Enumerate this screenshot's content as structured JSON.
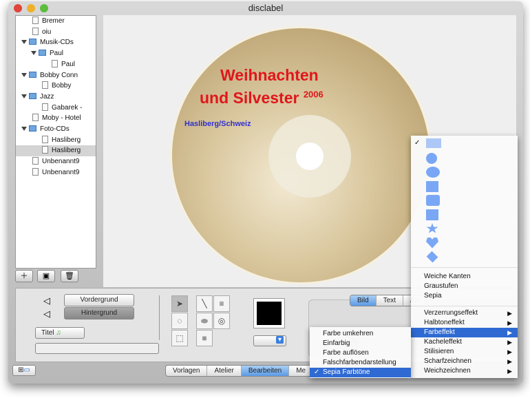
{
  "window": {
    "title": "disclabel"
  },
  "sidebar": {
    "items": [
      {
        "label": "Bremer",
        "type": "doc",
        "level": 1
      },
      {
        "label": "oiu",
        "type": "doc",
        "level": 1
      },
      {
        "label": "Musik-CDs",
        "type": "folder",
        "level": 0
      },
      {
        "label": "Paul",
        "type": "folder",
        "level": 1
      },
      {
        "label": "Paul",
        "type": "doc",
        "level": 3
      },
      {
        "label": "Bobby Conn",
        "type": "folder",
        "level": 0
      },
      {
        "label": "Bobby",
        "type": "doc",
        "level": 2
      },
      {
        "label": "Jazz",
        "type": "folder",
        "level": 0
      },
      {
        "label": "Gabarek -",
        "type": "doc",
        "level": 2
      },
      {
        "label": "Moby - Hotel",
        "type": "doc",
        "level": 1
      },
      {
        "label": "Foto-CDs",
        "type": "folder",
        "level": 0
      },
      {
        "label": "Hasliberg",
        "type": "doc",
        "level": 2
      },
      {
        "label": "Hasliberg",
        "type": "doc",
        "level": 2,
        "selected": true
      },
      {
        "label": "Unbenannt9",
        "type": "doc",
        "level": 1
      },
      {
        "label": "Unbenannt9",
        "type": "doc",
        "level": 1
      }
    ]
  },
  "disc": {
    "line1": "Weihnachten",
    "line2": "und Silvester",
    "year": "2006",
    "subtitle": "Hasliberg/Schweiz"
  },
  "panel": {
    "foreground": "Vordergrund",
    "background": "Hintergrund",
    "field_select": "Titel",
    "inspector_tabs": [
      "Bild",
      "Text",
      "Au"
    ]
  },
  "bottom_tabs": [
    "Vorlagen",
    "Atelier",
    "Bearbeiten",
    "Me"
  ],
  "shape_menu": {
    "shapes": [
      "rectangle",
      "circle",
      "ellipse",
      "square",
      "rounded-rectangle",
      "small-square",
      "star",
      "heart",
      "diamond"
    ],
    "items1": [
      "Weiche Kanten",
      "Graustufen",
      "Sepia"
    ],
    "items2": [
      "Verzerrungseffekt",
      "Halbtoneffekt",
      "Farbeffekt",
      "Kacheleffekt",
      "Stilisieren",
      "Scharfzeichnen",
      "Weichzeichnen"
    ]
  },
  "sub_menu": {
    "items": [
      "Farbe umkehren",
      "Einfarbig",
      "Farbe auflösen",
      "Falschfarbendarstellung",
      "Sepia Farbtöne"
    ],
    "checked": "✓"
  },
  "colors": {
    "accent": "#2f6ad3",
    "title_text": "#e0161b",
    "subtitle_text": "#3030d0"
  }
}
